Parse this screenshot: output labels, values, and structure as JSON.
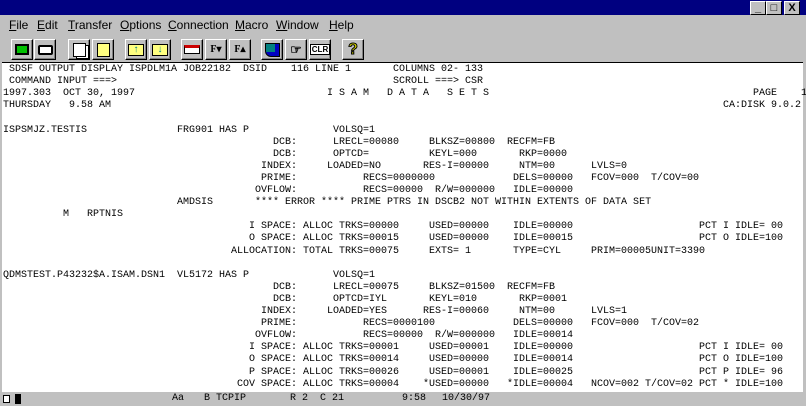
{
  "window": {
    "minimize": "_",
    "maximize": "□",
    "close": "X"
  },
  "menu": [
    "File",
    "Edit",
    "Transfer",
    "Options",
    "Connection",
    "Macro",
    "Window",
    "Help"
  ],
  "toolbar": {
    "clear_label": "CLR",
    "help_label": "?",
    "font_down": "F▾",
    "font_up": "F▴"
  },
  "terminal": {
    "header": {
      "title_line": "SDSF OUTPUT DISPLAY ISPDLM1A JOB22182  DSID    116 LINE 1",
      "columns": "COLUMNS 02- 133",
      "command_label": "COMMAND INPUT ===>",
      "scroll": "SCROLL ===> CSR",
      "date": "1997.303  OCT 30, 1997",
      "report_title": "I S A M   D A T A   S E T S",
      "page": "PAGE    1",
      "day_time": "THURSDAY   9.58 AM",
      "product": "CA:DISK 9.0.2"
    },
    "ds1": {
      "name": "ISPSMJZ.TESTIS",
      "vol": "FRG901 HAS P",
      "volsq": "VOLSQ=1",
      "dcb1": [
        "DCB:",
        "LRECL=00080",
        "BLKSZ=00800",
        "RECFM=FB"
      ],
      "dcb2": [
        "DCB:",
        "OPTCD=",
        "KEYL=000",
        "RKP=0000"
      ],
      "index": [
        "INDEX:",
        "LOADED=NO",
        "RES-I=00000",
        "NTM=00",
        "LVLS=0"
      ],
      "prime": [
        "PRIME:",
        "RECS=0000000",
        "DELS=00000",
        "FCOV=000",
        "T/COV=00"
      ],
      "ovflow": [
        "OVFLOW:",
        "RECS=00000",
        "R/W=000000",
        "IDLE=00000"
      ],
      "error": [
        "AMDSIS",
        "**** ERROR **** PRIME PTRS IN DSCB2 NOT WITHIN EXTENTS OF DATA SET"
      ],
      "module": [
        "M",
        "RPTNIS"
      ],
      "ispace": [
        "I SPACE:",
        "ALLOC TRKS=00000",
        "USED=00000",
        "IDLE=00000",
        "PCT I IDLE= 00"
      ],
      "ospace": [
        "O SPACE:",
        "ALLOC TRKS=00015",
        "USED=00000",
        "IDLE=00015",
        "PCT O IDLE=100"
      ],
      "alloc": [
        "ALLOCATION:",
        "TOTAL TRKS=00075",
        "EXTS= 1",
        "TYPE=CYL",
        "PRIM=00005",
        "UNIT=3390"
      ]
    },
    "ds2": {
      "name": "QDMSTEST.P43232$A.ISAM.DSN1",
      "vol": "VL5172 HAS P",
      "volsq": "VOLSQ=1",
      "dcb1": [
        "DCB:",
        "LRECL=00075",
        "BLKSZ=01500",
        "RECFM=FB"
      ],
      "dcb2": [
        "DCB:",
        "OPTCD=IYL",
        "KEYL=010",
        "RKP=0001"
      ],
      "index": [
        "INDEX:",
        "LOADED=YES",
        "RES-I=00060",
        "NTM=00",
        "LVLS=1"
      ],
      "prime": [
        "PRIME:",
        "RECS=0000100",
        "DELS=00000",
        "FCOV=000",
        "T/COV=02"
      ],
      "ovflow": [
        "OVFLOW:",
        "RECS=00000",
        "R/W=000000",
        "IDLE=00014"
      ],
      "ispace": [
        "I SPACE:",
        "ALLOC TRKS=00001",
        "USED=00001",
        "IDLE=00000",
        "PCT I IDLE= 00"
      ],
      "ospace": [
        "O SPACE:",
        "ALLOC TRKS=00014",
        "USED=00000",
        "IDLE=00014",
        "PCT O IDLE=100"
      ],
      "pspace": [
        "P SPACE:",
        "ALLOC TRKS=00026",
        "USED=00001",
        "IDLE=00025",
        "PCT P IDLE= 96"
      ],
      "covspace": [
        "COV SPACE:",
        "ALLOC TRKS=00004",
        "*USED=00000",
        "*IDLE=00004",
        "NCOV=002 T/COV=02",
        "PCT * IDLE=100"
      ]
    }
  },
  "status": {
    "case": "Aa",
    "session": "B TCPIP",
    "cursor": "R 2  C 21",
    "time": "9:58",
    "date": "10/30/97"
  }
}
